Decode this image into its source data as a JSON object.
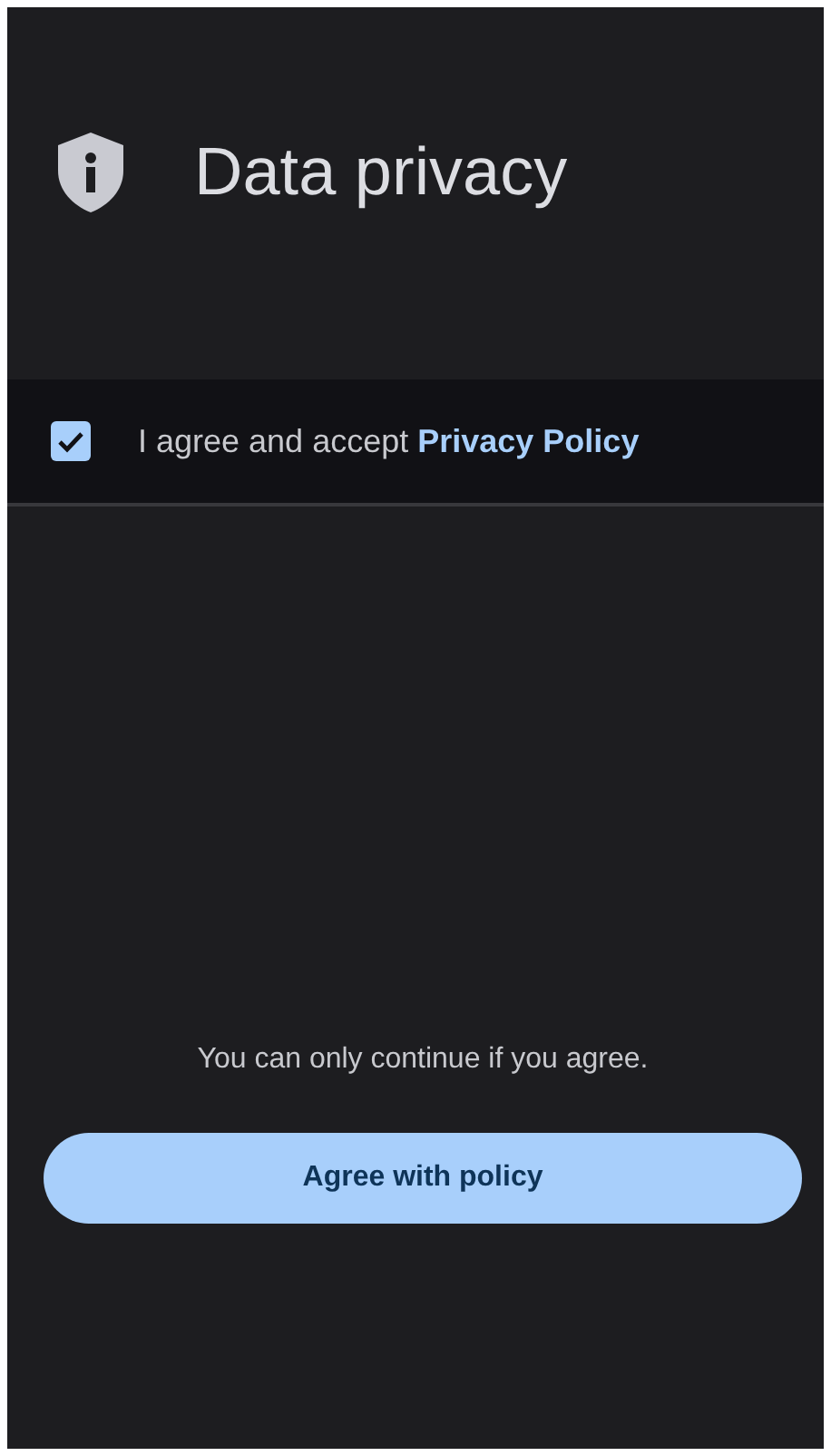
{
  "header": {
    "title": "Data privacy"
  },
  "consent": {
    "checked": true,
    "text": "I agree and accept",
    "link": "Privacy Policy"
  },
  "footer": {
    "note": "You can only continue if you agree.",
    "button": "Agree with policy"
  }
}
